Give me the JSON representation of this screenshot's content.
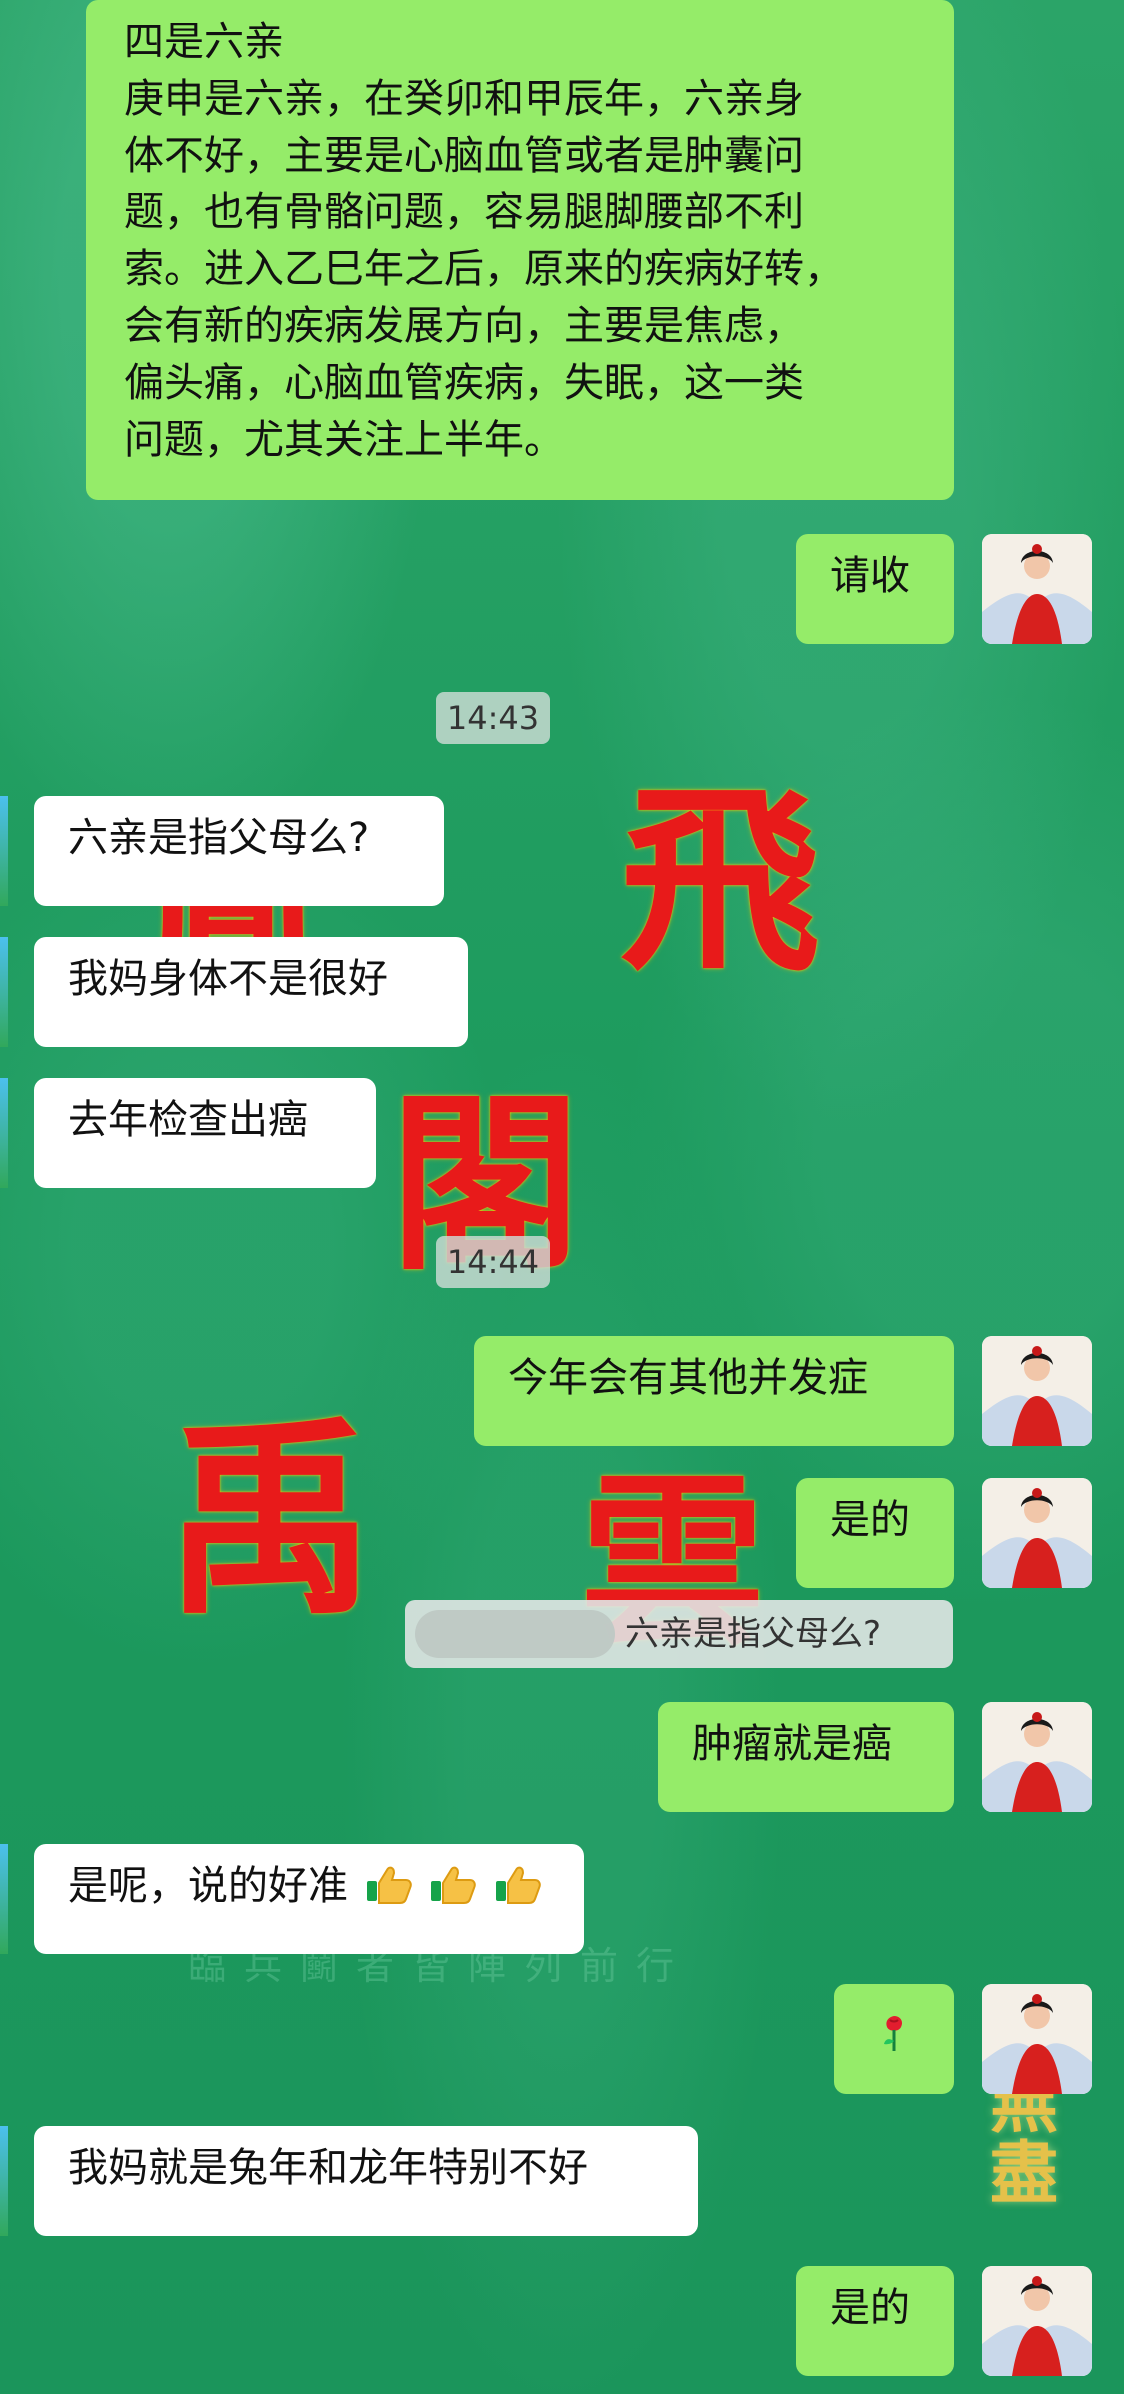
{
  "chat": {
    "background_colors": {
      "base": "#1f9a5d",
      "accent_red": "#e81a1a",
      "outgoing_bubble": "#95ec69",
      "incoming_bubble": "#ffffff"
    },
    "messages": [
      {
        "side": "outgoing",
        "lines": [
          "四是六亲",
          "庚申是六亲，在癸卯和甲辰年，六亲身",
          "体不好，主要是心脑血管或者是肿囊问",
          "题，也有骨骼问题，容易腿脚腰部不利",
          "索。进入乙巳年之后，原来的疾病好转，",
          "会有新的疾病发展方向，主要是焦虑，",
          "偏头痛，心脑血管疾病，失眠，这一类",
          "问题，尤其关注上半年。"
        ]
      },
      {
        "side": "outgoing",
        "text": "请收"
      },
      {
        "type": "timestamp",
        "text": "14:43"
      },
      {
        "side": "incoming",
        "text": "六亲是指父母么?"
      },
      {
        "side": "incoming",
        "text": "我妈身体不是很好"
      },
      {
        "side": "incoming",
        "text": "去年检查出癌"
      },
      {
        "type": "timestamp",
        "text": "14:44"
      },
      {
        "side": "outgoing",
        "text": "今年会有其他并发症"
      },
      {
        "side": "outgoing",
        "text": "是的"
      },
      {
        "type": "quote",
        "text": "六亲是指父母么?"
      },
      {
        "side": "outgoing",
        "text": "肿瘤就是癌"
      },
      {
        "side": "incoming",
        "text": "是呢，说的好准",
        "emoji": [
          "thumbs-up-icon",
          "thumbs-up-icon",
          "thumbs-up-icon"
        ]
      },
      {
        "side": "outgoing",
        "emoji": "rose-icon"
      },
      {
        "side": "incoming",
        "text": "我妈就是兔年和龙年特别不好"
      },
      {
        "side": "outgoing",
        "text": "是的"
      }
    ]
  }
}
